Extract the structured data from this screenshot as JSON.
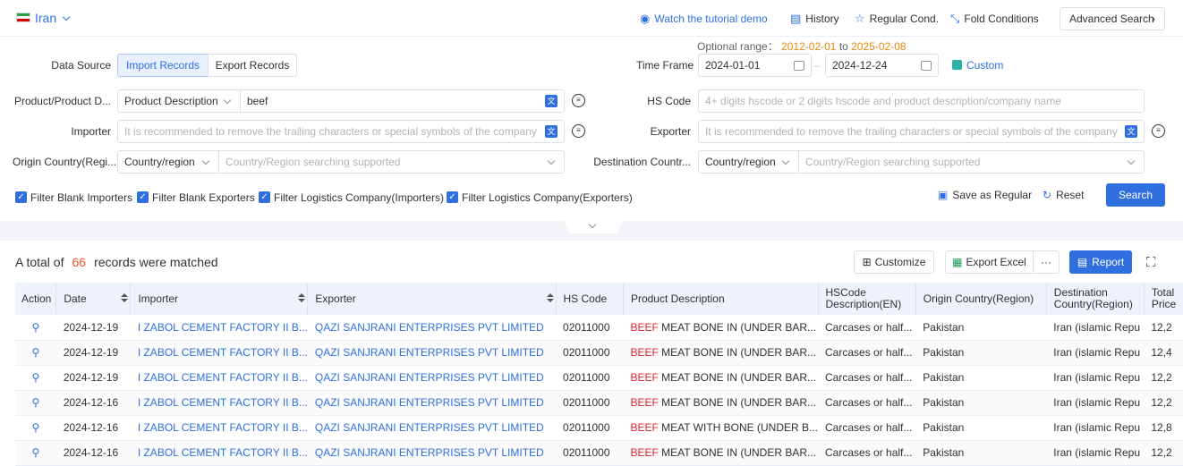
{
  "header": {
    "country": "Iran",
    "tutorial": "Watch the tutorial demo",
    "history": "History",
    "regular_cond": "Regular Cond.",
    "fold_conditions": "Fold Conditions",
    "advanced_search": "Advanced Search"
  },
  "optional_range": {
    "label": "Optional range：",
    "start": "2012-02-01",
    "to": "to",
    "end": "2025-02-08"
  },
  "data_source": {
    "label": "Data Source",
    "options": [
      "Import Records",
      "Export Records"
    ],
    "selected": "Import Records"
  },
  "time_frame": {
    "label": "Time Frame",
    "start": "2024-01-01",
    "end": "2024-12-24",
    "custom": "Custom"
  },
  "product": {
    "label": "Product/Product D...",
    "type": "Product Description",
    "value": "beef"
  },
  "hs_code": {
    "label": "HS Code",
    "placeholder": "4+ digits hscode or 2 digits hscode and product description/company name"
  },
  "importer": {
    "label": "Importer",
    "placeholder": "It is recommended to remove the trailing characters or special symbols of the company"
  },
  "exporter": {
    "label": "Exporter",
    "placeholder": "It is recommended to remove the trailing characters or special symbols of the company"
  },
  "origin": {
    "label": "Origin Country(Regi...",
    "type": "Country/region",
    "placeholder": "Country/Region searching supported"
  },
  "destination": {
    "label": "Destination Countr...",
    "type": "Country/region",
    "placeholder": "Country/Region searching supported"
  },
  "filters": [
    "Filter Blank Importers",
    "Filter Blank Exporters",
    "Filter Logistics Company(Importers)",
    "Filter Logistics Company(Exporters)"
  ],
  "actions": {
    "save_regular": "Save as Regular",
    "reset": "Reset",
    "search": "Search"
  },
  "results": {
    "prefix": "A total of",
    "count": "66",
    "suffix": "records were matched"
  },
  "toolbar": {
    "customize": "Customize",
    "export_excel": "Export Excel",
    "more": "···",
    "report": "Report"
  },
  "table": {
    "headers": [
      "Action",
      "Date",
      "Importer",
      "Exporter",
      "HS Code",
      "Product Description",
      "HSCode Description(EN)",
      "Origin Country(Region)",
      "Destination Country(Region)",
      "Total Price"
    ],
    "rows": [
      {
        "date": "2024-12-19",
        "importer": "I ZABOL CEMENT FACTORY II B...",
        "exporter": "QAZI SANJRANI ENTERPRISES PVT LIMITED",
        "hs": "02011000",
        "kw": "BEEF",
        "desc": " MEAT BONE IN (UNDER BAR...",
        "hsdesc": "Carcases or half...",
        "origin": "Pakistan",
        "dest": "Iran (islamic Repu",
        "price": "12,2"
      },
      {
        "date": "2024-12-19",
        "importer": "I ZABOL CEMENT FACTORY II B...",
        "exporter": "QAZI SANJRANI ENTERPRISES PVT LIMITED",
        "hs": "02011000",
        "kw": "BEEF",
        "desc": " MEAT BONE IN (UNDER BAR...",
        "hsdesc": "Carcases or half...",
        "origin": "Pakistan",
        "dest": "Iran (islamic Repu",
        "price": "12,4"
      },
      {
        "date": "2024-12-19",
        "importer": "I ZABOL CEMENT FACTORY II B...",
        "exporter": "QAZI SANJRANI ENTERPRISES PVT LIMITED",
        "hs": "02011000",
        "kw": "BEEF",
        "desc": " MEAT BONE IN (UNDER BAR...",
        "hsdesc": "Carcases or half...",
        "origin": "Pakistan",
        "dest": "Iran (islamic Repu",
        "price": "12,2"
      },
      {
        "date": "2024-12-16",
        "importer": "I ZABOL CEMENT FACTORY II B...",
        "exporter": "QAZI SANJRANI ENTERPRISES PVT LIMITED",
        "hs": "02011000",
        "kw": "BEEF",
        "desc": " MEAT BONE IN (UNDER BAR...",
        "hsdesc": "Carcases or half...",
        "origin": "Pakistan",
        "dest": "Iran (islamic Repu",
        "price": "12,2"
      },
      {
        "date": "2024-12-16",
        "importer": "I ZABOL CEMENT FACTORY II B...",
        "exporter": "QAZI SANJRANI ENTERPRISES PVT LIMITED",
        "hs": "02011000",
        "kw": "BEEF",
        "desc": " MEAT WITH BONE (UNDER B...",
        "hsdesc": "Carcases or half...",
        "origin": "Pakistan",
        "dest": "Iran (islamic Repu",
        "price": "12,8"
      },
      {
        "date": "2024-12-16",
        "importer": "I ZABOL CEMENT FACTORY II B...",
        "exporter": "QAZI SANJRANI ENTERPRISES PVT LIMITED",
        "hs": "02011000",
        "kw": "BEEF",
        "desc": " MEAT BONE IN (UNDER BAR...",
        "hsdesc": "Carcases or half...",
        "origin": "Pakistan",
        "dest": "Iran (islamic Repu",
        "price": "12,2"
      }
    ]
  },
  "colors": {
    "accent": "#2f6fe0",
    "count": "#f05a30",
    "range": "#e8890c",
    "keyword": "#e0242f"
  }
}
